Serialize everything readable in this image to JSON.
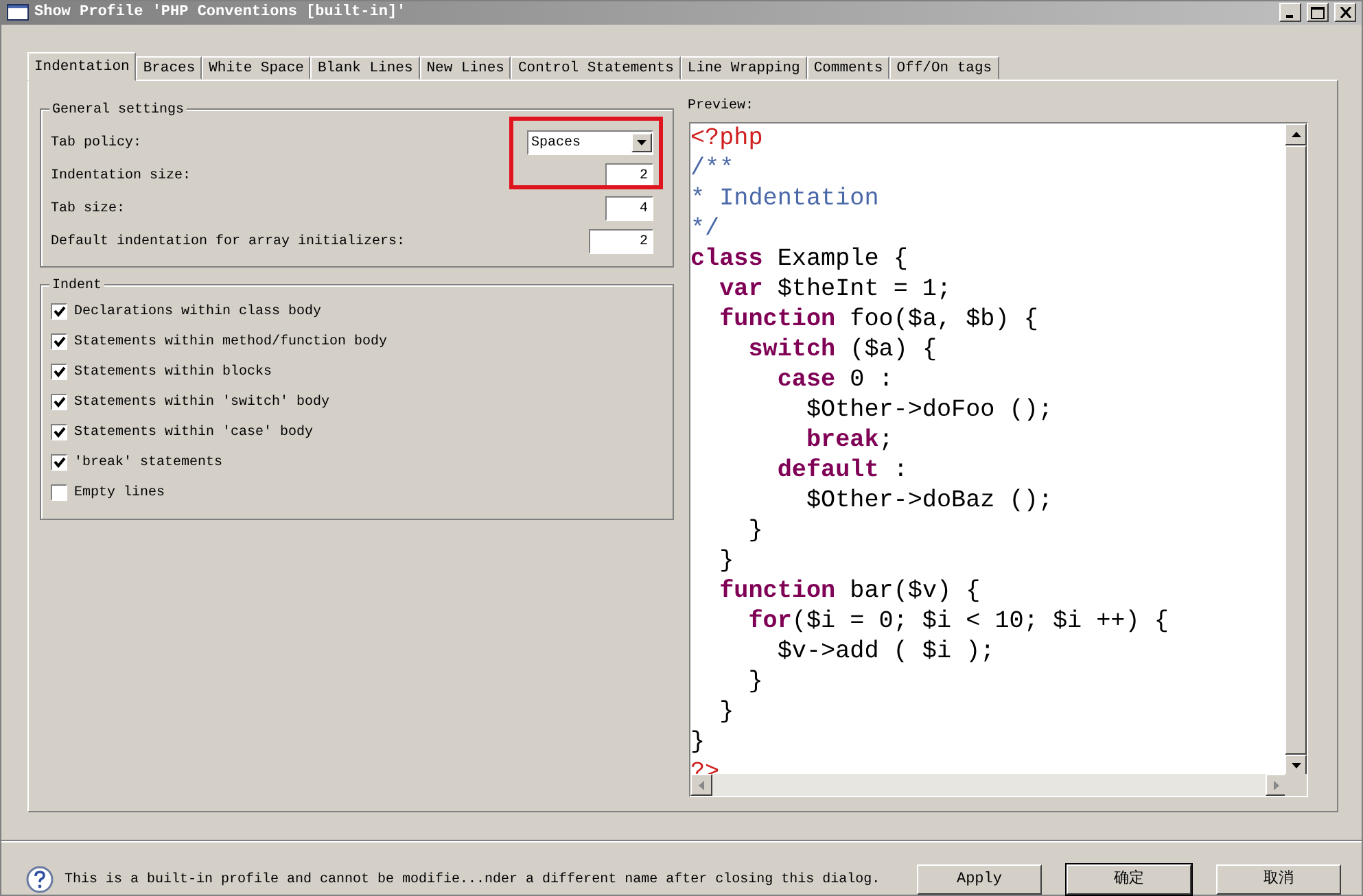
{
  "window": {
    "title": "Show Profile 'PHP Conventions [built-in]'"
  },
  "tabs": [
    {
      "label": "Indentation",
      "selected": true
    },
    {
      "label": "Braces",
      "selected": false
    },
    {
      "label": "White Space",
      "selected": false
    },
    {
      "label": "Blank Lines",
      "selected": false
    },
    {
      "label": "New Lines",
      "selected": false
    },
    {
      "label": "Control Statements",
      "selected": false
    },
    {
      "label": "Line Wrapping",
      "selected": false
    },
    {
      "label": "Comments",
      "selected": false
    },
    {
      "label": "Off/On tags",
      "selected": false
    }
  ],
  "general_settings": {
    "title": "General settings",
    "fields": [
      {
        "kind": "dropdown",
        "label": "Tab policy:",
        "value": "Spaces"
      },
      {
        "kind": "number",
        "label": "Indentation size:",
        "value": "2"
      },
      {
        "kind": "number",
        "label": "Tab size:",
        "value": "4"
      },
      {
        "kind": "number",
        "label": "Default indentation for array initializers:",
        "value": "2"
      }
    ]
  },
  "indent": {
    "title": "Indent",
    "options": [
      {
        "label": "Declarations within class body",
        "checked": true
      },
      {
        "label": "Statements within method/function body",
        "checked": true
      },
      {
        "label": "Statements within blocks",
        "checked": true
      },
      {
        "label": "Statements within 'switch' body",
        "checked": true
      },
      {
        "label": "Statements within 'case' body",
        "checked": true
      },
      {
        "label": "'break' statements",
        "checked": true
      },
      {
        "label": "Empty lines",
        "checked": false
      }
    ]
  },
  "preview": {
    "label": "Preview:",
    "lines": [
      [
        {
          "kind": "tag",
          "text": "<?php"
        }
      ],
      [
        {
          "kind": "comment",
          "text": "/**"
        }
      ],
      [
        {
          "kind": "comment",
          "text": "* Indentation"
        }
      ],
      [
        {
          "kind": "comment",
          "text": "*/"
        }
      ],
      [
        {
          "kind": "keyword",
          "text": "class"
        },
        {
          "kind": "plain",
          "text": " Example {"
        }
      ],
      [
        {
          "kind": "keyword",
          "text": "  var"
        },
        {
          "kind": "plain",
          "text": " $theInt = 1;"
        }
      ],
      [
        {
          "kind": "keyword",
          "text": "  function"
        },
        {
          "kind": "plain",
          "text": " foo($a, $b) {"
        }
      ],
      [
        {
          "kind": "keyword",
          "text": "    switch"
        },
        {
          "kind": "plain",
          "text": " ($a) {"
        }
      ],
      [
        {
          "kind": "keyword",
          "text": "      case"
        },
        {
          "kind": "plain",
          "text": " 0 :"
        }
      ],
      [
        {
          "kind": "plain",
          "text": "        $Other->doFoo ();"
        }
      ],
      [
        {
          "kind": "keyword",
          "text": "        break"
        },
        {
          "kind": "plain",
          "text": ";"
        }
      ],
      [
        {
          "kind": "keyword",
          "text": "      default"
        },
        {
          "kind": "plain",
          "text": " :"
        }
      ],
      [
        {
          "kind": "plain",
          "text": "        $Other->doBaz ();"
        }
      ],
      [
        {
          "kind": "plain",
          "text": "    }"
        }
      ],
      [
        {
          "kind": "plain",
          "text": "  }"
        }
      ],
      [
        {
          "kind": "keyword",
          "text": "  function"
        },
        {
          "kind": "plain",
          "text": " bar($v) {"
        }
      ],
      [
        {
          "kind": "keyword",
          "text": "    for"
        },
        {
          "kind": "plain",
          "text": "($i = 0; $i < 10; $i ++) {"
        }
      ],
      [
        {
          "kind": "plain",
          "text": "      $v->add ( $i );"
        }
      ],
      [
        {
          "kind": "plain",
          "text": "    }"
        }
      ],
      [
        {
          "kind": "plain",
          "text": "  }"
        }
      ],
      [
        {
          "kind": "plain",
          "text": "}"
        }
      ],
      [
        {
          "kind": "tag",
          "text": "?>"
        }
      ]
    ]
  },
  "status": {
    "message": "This is a built-in profile and cannot be modifie...nder a different name after closing this dialog."
  },
  "buttons": [
    {
      "label": "Apply",
      "default": false
    },
    {
      "label": "确定",
      "default": true
    },
    {
      "label": "取消",
      "default": false
    }
  ]
}
